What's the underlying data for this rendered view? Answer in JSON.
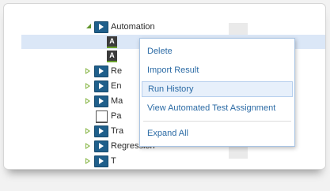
{
  "tree": {
    "root": {
      "label": "Automation"
    },
    "rows": [
      {
        "icon": "test-icon",
        "glyph": "A",
        "label": ""
      },
      {
        "icon": "test-icon",
        "glyph": "A",
        "label": ""
      },
      {
        "icon": "folder-icon",
        "label": "Re"
      },
      {
        "icon": "folder-icon",
        "label": "En"
      },
      {
        "icon": "folder-icon",
        "label": "Ma"
      },
      {
        "icon": "test-icon",
        "glyph": "",
        "label": "Pa"
      },
      {
        "icon": "folder-icon",
        "label": "Tra"
      },
      {
        "icon": "folder-icon",
        "label": "Regression"
      },
      {
        "icon": "folder-icon",
        "label": "T"
      }
    ]
  },
  "context_menu": {
    "items": [
      {
        "label": "Delete"
      },
      {
        "label": "Import Result"
      },
      {
        "label": "Run History"
      },
      {
        "label": "View Automated Test Assignment"
      },
      {
        "label": "Expand All"
      }
    ]
  },
  "colors": {
    "accent_link": "#2c6ba5",
    "selection": "#dbe7f7",
    "expander_green": "#8ab84a",
    "folder_blue": "#1f5f8b"
  }
}
